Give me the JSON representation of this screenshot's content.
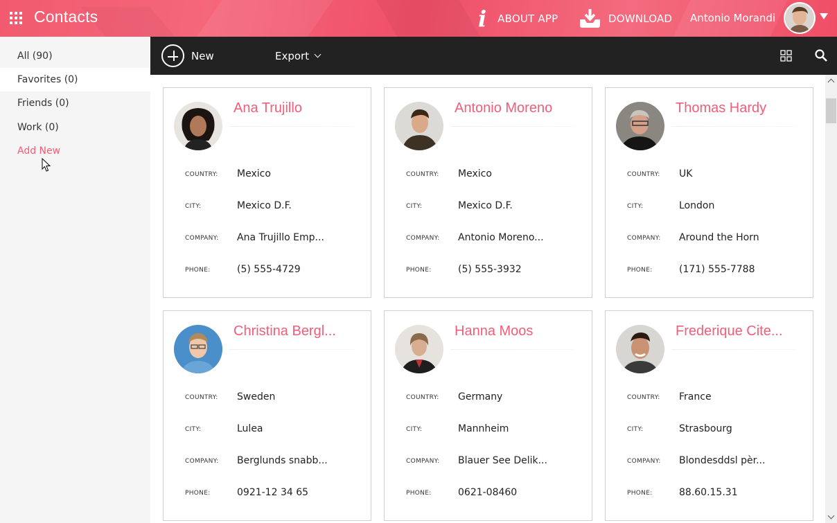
{
  "header": {
    "app_title": "Contacts",
    "about_label": "ABOUT APP",
    "download_label": "DOWNLOAD",
    "user_name": "Antonio Morandi",
    "colors": {
      "accent": "#f25d78",
      "header_bg": "#f25a6f",
      "toolbar_bg": "#222222"
    },
    "icons": [
      "apps-grid-icon",
      "info-icon",
      "download-icon",
      "avatar",
      "caret-down-icon"
    ]
  },
  "sidebar": {
    "items": [
      {
        "label": "All (90)"
      },
      {
        "label": "Favorites (0)"
      },
      {
        "label": "Friends (0)"
      },
      {
        "label": "Work (0)"
      },
      {
        "label": "Add New"
      }
    ]
  },
  "toolbar": {
    "new_label": "New",
    "export_label": "Export",
    "icons": [
      "plus-circle-icon",
      "chevron-down-icon",
      "card-view-icon",
      "search-icon"
    ]
  },
  "field_labels": {
    "country": "COUNTRY:",
    "city": "CITY:",
    "company": "COMPANY:",
    "phone": "PHONE:"
  },
  "contacts": [
    {
      "name": "Ana Trujillo",
      "country": "Mexico",
      "city": "Mexico D.F.",
      "company": "Ana Trujillo Emp...",
      "phone": "(5) 555-4729"
    },
    {
      "name": "Antonio Moreno",
      "country": "Mexico",
      "city": "Mexico D.F.",
      "company": "Antonio Moreno...",
      "phone": "(5) 555-3932"
    },
    {
      "name": "Thomas Hardy",
      "country": "UK",
      "city": "London",
      "company": "Around the Horn",
      "phone": "(171) 555-7788"
    },
    {
      "name": "Christina Bergl...",
      "country": "Sweden",
      "city": "Lulea",
      "company": "Berglunds snabb...",
      "phone": "0921-12 34 65"
    },
    {
      "name": "Hanna Moos",
      "country": "Germany",
      "city": "Mannheim",
      "company": "Blauer See Delik...",
      "phone": "0621-08460"
    },
    {
      "name": "Frederique Cite...",
      "country": "France",
      "city": "Strasbourg",
      "company": "Blondesddsl pèr...",
      "phone": "88.60.15.31"
    }
  ]
}
